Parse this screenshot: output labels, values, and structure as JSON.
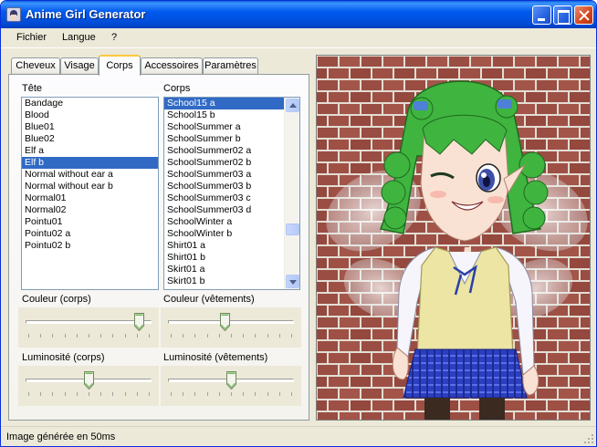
{
  "window": {
    "title": "Anime Girl Generator"
  },
  "menu": {
    "items": [
      "Fichier",
      "Langue",
      "?"
    ]
  },
  "tabs": [
    {
      "label": "Cheveux",
      "active": false
    },
    {
      "label": "Visage",
      "active": false
    },
    {
      "label": "Corps",
      "active": true
    },
    {
      "label": "Accessoires",
      "active": false
    },
    {
      "label": "Paramètres",
      "active": false
    }
  ],
  "head_list": {
    "label": "Tête",
    "items": [
      "Bandage",
      "Blood",
      "Blue01",
      "Blue02",
      "Elf a",
      "Elf b",
      "Normal without ear a",
      "Normal without ear b",
      "Normal01",
      "Normal02",
      "Pointu01",
      "Pointu02 a",
      "Pointu02 b"
    ],
    "selected": "Elf b"
  },
  "body_list": {
    "label": "Corps",
    "items": [
      "School15 a",
      "School15 b",
      "SchoolSummer a",
      "SchoolSummer b",
      "SchoolSummer02 a",
      "SchoolSummer02 b",
      "SchoolSummer03 a",
      "SchoolSummer03 b",
      "SchoolSummer03 c",
      "SchoolSummer03 d",
      "SchoolWinter a",
      "SchoolWinter b",
      "Shirt01 a",
      "Shirt01 b",
      "Skirt01 a",
      "Skirt01 b"
    ],
    "selected": "School15 a"
  },
  "sliders": {
    "body_color": {
      "label": "Couleur (corps)",
      "value": 0.92
    },
    "clothes_color": {
      "label": "Couleur (vêtements)",
      "value": 0.45
    },
    "body_brightness": {
      "label": "Luminosité (corps)",
      "value": 0.5
    },
    "clothes_brightness": {
      "label": "Luminosité (vêtements)",
      "value": 0.5
    }
  },
  "status": {
    "text": "Image générée en 50ms"
  },
  "colors": {
    "titlebar": "#0058ee",
    "selection": "#316ac5",
    "hair": "#3fb43f",
    "brick": "#9a4d42",
    "mortar": "#e3ddd3",
    "vest": "#ece5a4",
    "skirt": "#2b3fc0"
  }
}
